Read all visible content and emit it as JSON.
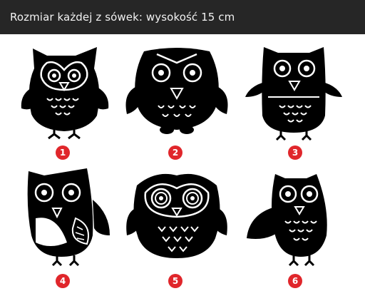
{
  "header": {
    "title": "Rozmiar każdej z sówek: wysokość 15 cm"
  },
  "colors": {
    "header_bg": "#262626",
    "owl": "#000000",
    "badge": "#e0262b",
    "badge_text": "#ffffff"
  },
  "owls": [
    {
      "number": "1"
    },
    {
      "number": "2"
    },
    {
      "number": "3"
    },
    {
      "number": "4"
    },
    {
      "number": "5"
    },
    {
      "number": "6"
    }
  ]
}
